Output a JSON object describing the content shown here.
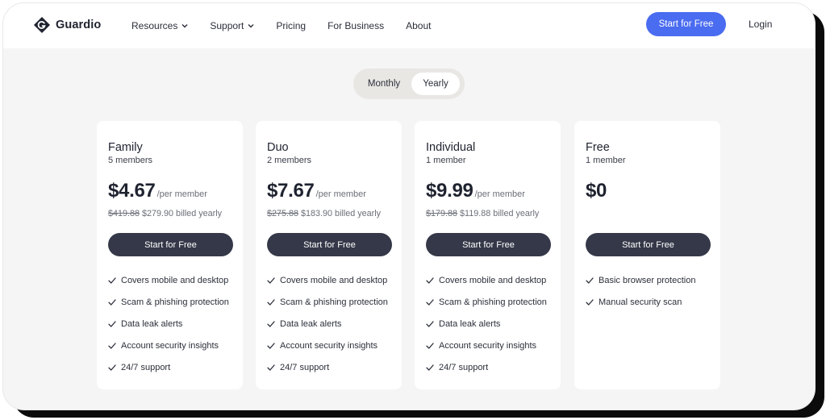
{
  "brand": {
    "name": "Guardio"
  },
  "nav": {
    "items": [
      {
        "label": "Resources",
        "dropdown": true
      },
      {
        "label": "Support",
        "dropdown": true
      },
      {
        "label": "Pricing",
        "dropdown": false
      },
      {
        "label": "For Business",
        "dropdown": false
      },
      {
        "label": "About",
        "dropdown": false
      }
    ],
    "cta_label": "Start for Free",
    "login_label": "Login"
  },
  "billing_toggle": {
    "options": [
      "Monthly",
      "Yearly"
    ],
    "selected": "Yearly"
  },
  "plans": [
    {
      "name": "Family",
      "members": "5 members",
      "price": "$4.67",
      "unit": "/per member",
      "old_price": "$419.88",
      "billed": "$279.90 billed yearly",
      "button": "Start for Free",
      "features": [
        "Covers mobile and desktop",
        "Scam & phishing protection",
        "Data leak alerts",
        "Account security insights",
        "24/7 support"
      ]
    },
    {
      "name": "Duo",
      "members": "2 members",
      "price": "$7.67",
      "unit": "/per member",
      "old_price": "$275.88",
      "billed": "$183.90 billed yearly",
      "button": "Start for Free",
      "features": [
        "Covers mobile and desktop",
        "Scam & phishing protection",
        "Data leak alerts",
        "Account security insights",
        "24/7 support"
      ]
    },
    {
      "name": "Individual",
      "members": "1 member",
      "price": "$9.99",
      "unit": "/per member",
      "old_price": "$179.88",
      "billed": "$119.88 billed yearly",
      "button": "Start for Free",
      "features": [
        "Covers mobile and desktop",
        "Scam & phishing protection",
        "Data leak alerts",
        "Account security insights",
        "24/7 support"
      ]
    },
    {
      "name": "Free",
      "members": "1 member",
      "price": "$0",
      "unit": "",
      "old_price": "",
      "billed": "",
      "button": "Start for Free",
      "features": [
        "Basic browser protection",
        "Manual security scan"
      ]
    }
  ],
  "colors": {
    "accent": "#4a6cf0",
    "button_dark": "#343848",
    "page_bg": "#f5f5f6"
  },
  "icons": {
    "logo": "guardio-logo-icon",
    "dropdown": "chevron-down-icon",
    "feature": "check-icon"
  }
}
